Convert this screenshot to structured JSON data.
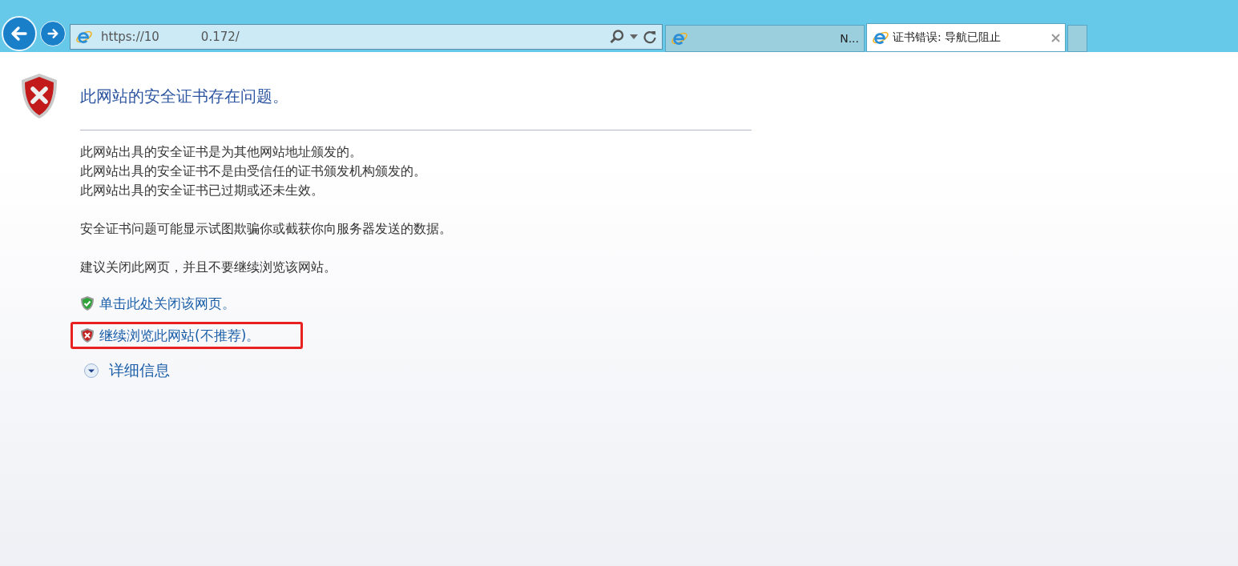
{
  "address_bar": {
    "url_start": "https://10",
    "url_end": "0.172/"
  },
  "tabs": [
    {
      "title": "N...",
      "selected": false
    },
    {
      "title": "证书错误: 导航已阻止",
      "selected": true
    }
  ],
  "page": {
    "heading": "此网站的安全证书存在问题。",
    "paragraphs": [
      [
        "此网站出具的安全证书是为其他网站地址颁发的。",
        "此网站出具的安全证书不是由受信任的证书颁发机构颁发的。",
        "此网站出具的安全证书已过期或还未生效。"
      ],
      [
        "安全证书问题可能显示试图欺骗你或截获你向服务器发送的数据。"
      ],
      [
        "建议关闭此网页，并且不要继续浏览该网站。"
      ]
    ],
    "links": [
      {
        "kind": "safe",
        "label": "单击此处关闭该网页。",
        "highlighted": false
      },
      {
        "kind": "unsafe",
        "label": "继续浏览此网站(不推荐)。",
        "highlighted": true
      }
    ],
    "details": {
      "label": "详细信息",
      "expanded": false
    }
  }
}
